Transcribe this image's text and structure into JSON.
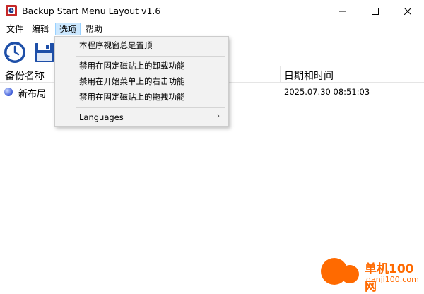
{
  "window": {
    "title": "Backup Start Menu Layout v1.6",
    "minimize_icon": "minimize-icon",
    "maximize_icon": "maximize-icon",
    "close_icon": "close-icon"
  },
  "menubar": {
    "items": [
      "文件",
      "编辑",
      "选项",
      "帮助"
    ],
    "active": "选项"
  },
  "toolbar": {
    "buttons": [
      "clock-restore-icon",
      "floppy-save-icon"
    ]
  },
  "list": {
    "columns": [
      "备份名称",
      "日期和时间"
    ],
    "rows": [
      {
        "name": "新布局",
        "date": "2025.07.30 08:51:03"
      }
    ]
  },
  "options_menu": {
    "items": [
      "本程序视窗总是置顶",
      "禁用在固定磁贴上的卸载功能",
      "禁用在开始菜单上的右击功能",
      "禁用在固定磁贴上的拖拽功能",
      "Languages"
    ],
    "submenu_arrow": "›"
  },
  "watermark": {
    "cn": "单机100网",
    "url": "danji100.com"
  },
  "colors": {
    "accent": "#cce8ff",
    "watermark": "#ff6a00",
    "menu_bg": "#f2f2f2"
  }
}
